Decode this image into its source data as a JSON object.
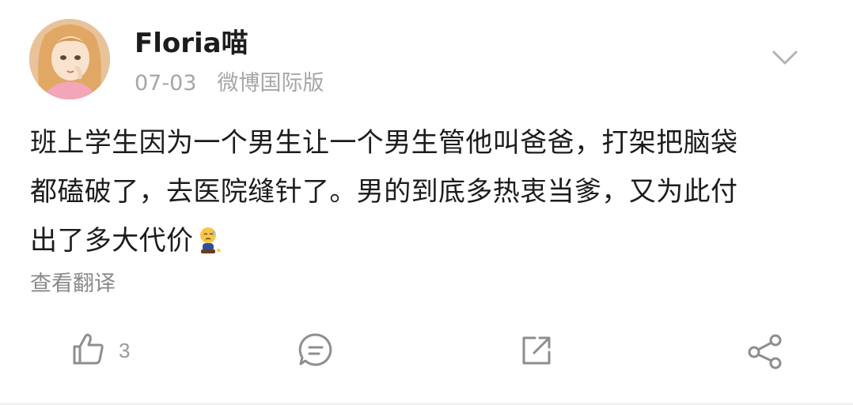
{
  "user": {
    "name": "Floria喵",
    "date": "07-03",
    "source": "微博国际版"
  },
  "post": {
    "lines": [
      "班上学生因为一个男生让一个男生管他叫爸爸，打架把脑袋",
      "都磕破了，去医院缝针了。男的到底多热衷当爹，又为此付",
      "出了多大代价"
    ],
    "emoji": "sweat-sad-emoji"
  },
  "translate_label": "查看翻译",
  "actions": {
    "like_count": "3",
    "icons": [
      "thumb-up-icon",
      "comment-icon",
      "repost-icon",
      "share-icon"
    ]
  },
  "colors": {
    "text": "#1c1c1c",
    "meta": "#a6a6a6",
    "icon": "#8e8e8e"
  }
}
